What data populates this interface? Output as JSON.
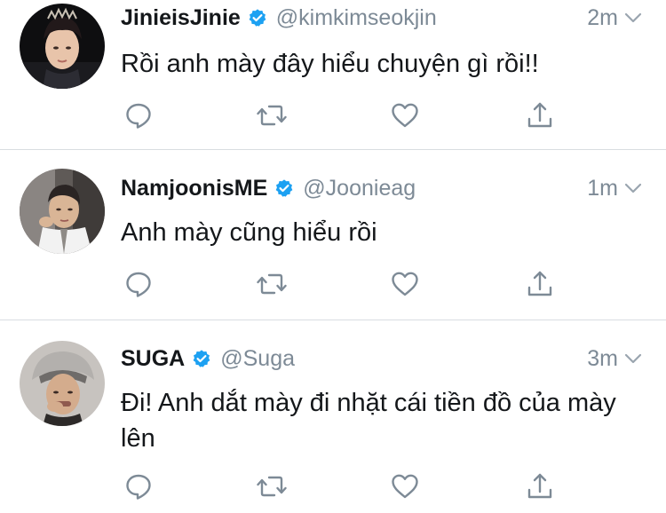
{
  "colors": {
    "verified_badge": "#1da1f2",
    "secondary_text": "#7d8a96",
    "primary_text": "#14171a",
    "action_icon": "#7d8a96",
    "divider": "#d9dde1"
  },
  "tweets": [
    {
      "display_name": "JinieisJinie",
      "handle": "@kimkimseokjin",
      "time": "2m",
      "text": "Rồi anh mày đây hiểu chuyện gì rồi!!",
      "avatar_icon": "avatar-photo",
      "verified": true
    },
    {
      "display_name": "NamjoonisME",
      "handle": "@Joonieag",
      "time": "1m",
      "text": "Anh mày cũng hiểu rồi",
      "avatar_icon": "avatar-photo",
      "verified": true
    },
    {
      "display_name": "SUGA",
      "handle": "@Suga",
      "time": "3m",
      "text": "Đi! Anh dắt mày đi nhặt cái tiền đồ của mày lên",
      "avatar_icon": "avatar-photo",
      "verified": true
    }
  ],
  "action_icons": [
    "reply-icon",
    "retweet-icon",
    "like-icon",
    "share-icon"
  ]
}
